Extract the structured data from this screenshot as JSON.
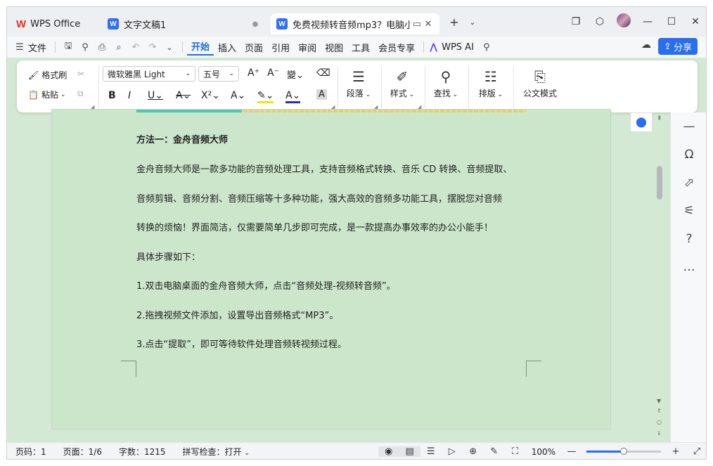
{
  "tabs": [
    {
      "label": "WPS Office",
      "icon": "wps-logo-icon"
    },
    {
      "label": "文字文稿1",
      "icon": "writer-doc-icon"
    },
    {
      "label": "免费视频转音频mp3？电脑小",
      "icon": "writer-doc-icon"
    }
  ],
  "menu": {
    "file": "文件",
    "items": [
      "开始",
      "插入",
      "页面",
      "引用",
      "审阅",
      "视图",
      "工具",
      "会员专享"
    ],
    "wps_ai": "WPS AI",
    "share": "分享"
  },
  "ribbon": {
    "format_painter": "格式刷",
    "paste": "粘贴",
    "font_name": "微软雅黑 Light",
    "font_size": "五号",
    "paragraph": "段落",
    "styles": "样式",
    "find": "查找",
    "layout": "排版",
    "official_mode": "公文模式"
  },
  "document": {
    "heading": "方法一：金舟音频大师",
    "paragraph_lines": [
      "金舟音频大师是一款多功能的音频处理工具，支持音频格式转换、音乐 CD 转换、音频提取、",
      "音频剪辑、音频分割、音频压缩等十多种功能，强大高效的音频多功能工具，摆脱您对音频",
      "转换的烦恼！界面简洁，仅需要简单几步即可完成，是一款提高办事效率的办公小能手！"
    ],
    "steps_intro": "具体步骤如下：",
    "steps": [
      "1.双击电脑桌面的金舟音频大师，点击“音频处理-视频转音频”。",
      "2.拖拽视频文件添加，设置导出音频格式“MP3”。",
      "3.点击“提取”，即可等待软件处理音频转视频过程。"
    ]
  },
  "status": {
    "page_code": "页码：1",
    "page": "页面：1/6",
    "word_count": "字数：1215",
    "spell_check": "拼写检查：打开",
    "zoom": "100%",
    "zoom_fraction": 0.5
  },
  "colors": {
    "accent": "#2a6ef0",
    "doc_background": "#cbe6cb"
  }
}
